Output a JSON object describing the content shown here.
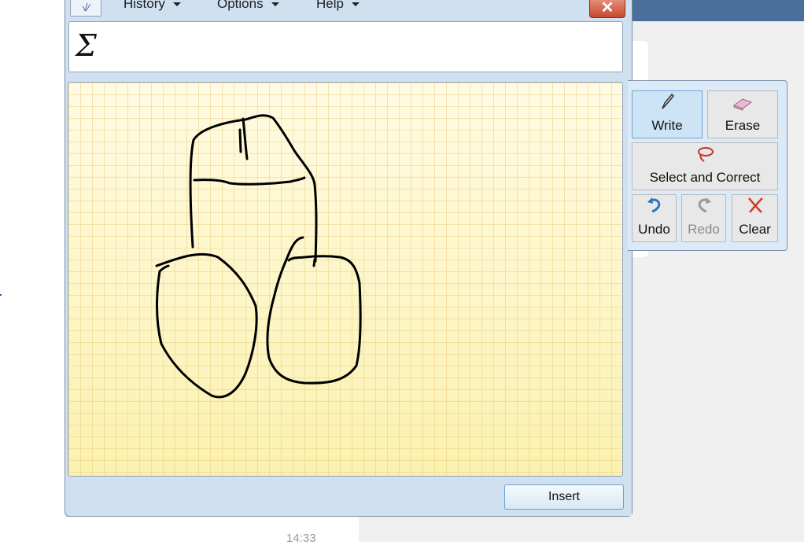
{
  "menu": {
    "history": "History",
    "options": "Options",
    "help": "Help",
    "close_symbol": "✕"
  },
  "preview": {
    "text": "Σ"
  },
  "tools": {
    "write": "Write",
    "erase": "Erase",
    "select_correct": "Select and Correct",
    "undo": "Undo",
    "redo": "Redo",
    "clear": "Clear"
  },
  "insert": {
    "label": "Insert"
  },
  "background": {
    "time": "14:33"
  },
  "colors": {
    "canvas_top": "#fffbe3",
    "canvas_bottom": "#fbf1b0",
    "window_frame": "#cfe0f1",
    "close_red": "#c8472c",
    "accent_blue": "#4a6f9a"
  },
  "icons": {
    "app": "math-panel-icon",
    "write": "pen-icon",
    "erase": "eraser-icon",
    "select": "lasso-icon",
    "undo": "undo-arrow-icon",
    "redo": "redo-arrow-icon",
    "clear": "red-x-icon"
  }
}
